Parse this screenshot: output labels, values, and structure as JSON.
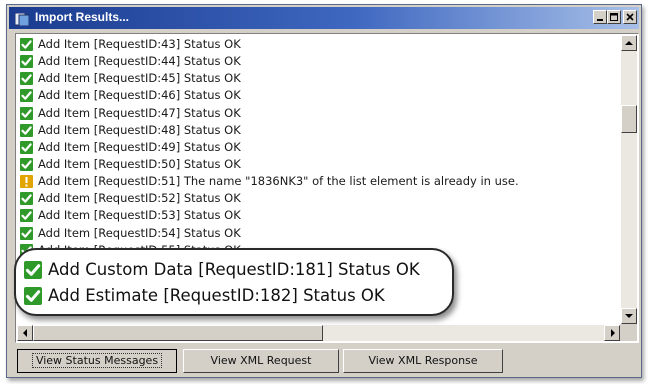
{
  "window": {
    "title": "Import Results...",
    "controls": [
      "minimize",
      "maximize",
      "close"
    ]
  },
  "log": {
    "rows": [
      {
        "status": "ok",
        "text": "Add Item [RequestID:43] Status OK"
      },
      {
        "status": "ok",
        "text": "Add Item [RequestID:44] Status OK"
      },
      {
        "status": "ok",
        "text": "Add Item [RequestID:45] Status OK"
      },
      {
        "status": "ok",
        "text": "Add Item [RequestID:46] Status OK"
      },
      {
        "status": "ok",
        "text": "Add Item [RequestID:47] Status OK"
      },
      {
        "status": "ok",
        "text": "Add Item [RequestID:48] Status OK"
      },
      {
        "status": "ok",
        "text": "Add Item [RequestID:49] Status OK"
      },
      {
        "status": "ok",
        "text": "Add Item [RequestID:50] Status OK"
      },
      {
        "status": "warning",
        "text": "Add Item [RequestID:51] The name \"1836NK3\" of the list element is already in use."
      },
      {
        "status": "ok",
        "text": "Add Item [RequestID:52] Status OK"
      },
      {
        "status": "ok",
        "text": "Add Item [RequestID:53] Status OK"
      },
      {
        "status": "ok",
        "text": "Add Item [RequestID:54] Status OK"
      },
      {
        "status": "ok",
        "text": "Add Item [RequestID:55] Status OK"
      }
    ]
  },
  "callout": {
    "rows": [
      {
        "status": "ok",
        "text": "Add Custom Data [RequestID:181] Status OK"
      },
      {
        "status": "ok",
        "text": "Add Estimate [RequestID:182] Status OK"
      }
    ]
  },
  "buttons": {
    "status_messages": "View Status Messages",
    "xml_request": "View XML Request",
    "xml_response": "View XML Response"
  },
  "icons": {
    "ok": "green-check-icon",
    "warning": "yellow-warning-icon"
  },
  "colors": {
    "titlebar_start": "#1a3b8f",
    "titlebar_end": "#a8c0e8",
    "ok": "#2f9a2a",
    "warning": "#e2a400",
    "chrome": "#d4d0c8"
  }
}
